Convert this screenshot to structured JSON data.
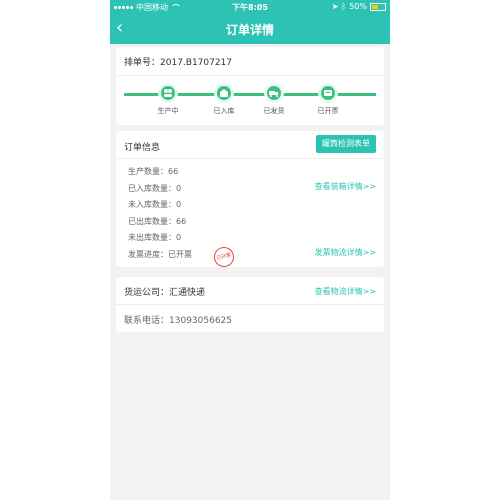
{
  "status_bar": {
    "carrier": "中国移动",
    "time": "下午8:05",
    "battery": "50%",
    "battery_color": "#ffcc00"
  },
  "nav": {
    "title": "订单详情",
    "back_label": "‹"
  },
  "order": {
    "number_label": "排单号：",
    "number": "2017.B1707217",
    "steps": [
      {
        "label": "生产中",
        "icon": "workers-icon"
      },
      {
        "label": "已入库",
        "icon": "warehouse-icon"
      },
      {
        "label": "已发货",
        "icon": "truck-icon"
      },
      {
        "label": "已开票",
        "icon": "invoice-icon"
      }
    ]
  },
  "info": {
    "title": "订单信息",
    "button": "罐筒检测表单",
    "rows": [
      {
        "label": "生产数量：",
        "value": "66"
      },
      {
        "label": "已入库数量：",
        "value": "0"
      },
      {
        "label": "未入库数量：",
        "value": "0"
      },
      {
        "label": "已出库数量：",
        "value": "66"
      },
      {
        "label": "未出库数量：",
        "value": "0"
      },
      {
        "label": "发票进度：",
        "value": "已开票"
      }
    ],
    "link_packing": "查看装箱详情>>",
    "link_invoice": "发票物流详情>>",
    "stamp": "已开票"
  },
  "shipping": {
    "company_label": "货运公司：",
    "company": "汇通快递",
    "link": "查看物流详情>>",
    "phone_label": "联系电话：",
    "phone": "13093056625"
  },
  "colors": {
    "accent": "#2dc3b4",
    "progress": "#3cc080",
    "stamp": "#dd4444"
  }
}
